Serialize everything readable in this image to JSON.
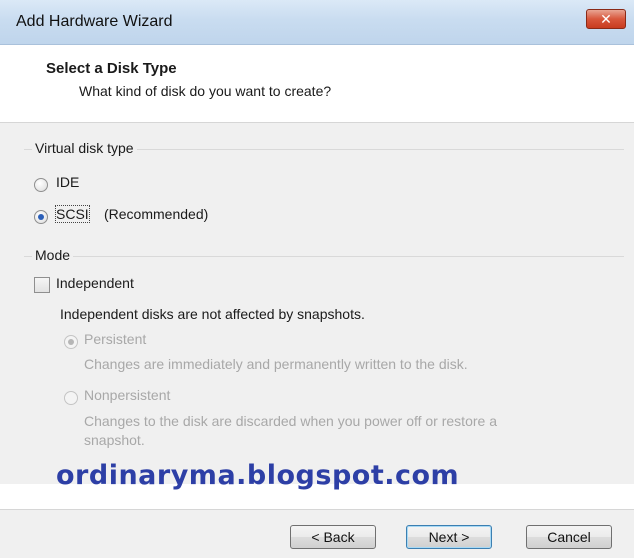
{
  "window": {
    "title": "Add Hardware Wizard",
    "close_glyph": "✕"
  },
  "header": {
    "title": "Select a Disk Type",
    "subtitle": "What kind of disk do you want to create?"
  },
  "virtual_disk": {
    "group_label": "Virtual disk type",
    "options": [
      {
        "label": "IDE",
        "suffix": "",
        "selected": false
      },
      {
        "label": "SCSI",
        "suffix": "(Recommended)",
        "selected": true
      }
    ]
  },
  "mode": {
    "group_label": "Mode",
    "independent_label": "Independent",
    "independent_checked": false,
    "description": "Independent disks are not affected by snapshots.",
    "persistent": {
      "label": "Persistent",
      "description": "Changes are immediately and permanently written to the disk.",
      "selected": true,
      "enabled": false
    },
    "nonpersistent": {
      "label": "Nonpersistent",
      "description_line1": "Changes to the disk are discarded when you power off or restore a",
      "description_line2": "snapshot.",
      "selected": false,
      "enabled": false
    }
  },
  "watermark": "ordinaryma.blogspot.com",
  "buttons": {
    "back": "< Back",
    "next": "Next >",
    "cancel": "Cancel"
  },
  "colors": {
    "titlebar": "#c9dcf0",
    "close": "#d8573c",
    "watermark": "#2d3fa6",
    "radio_dot": "#2b5fb8"
  }
}
